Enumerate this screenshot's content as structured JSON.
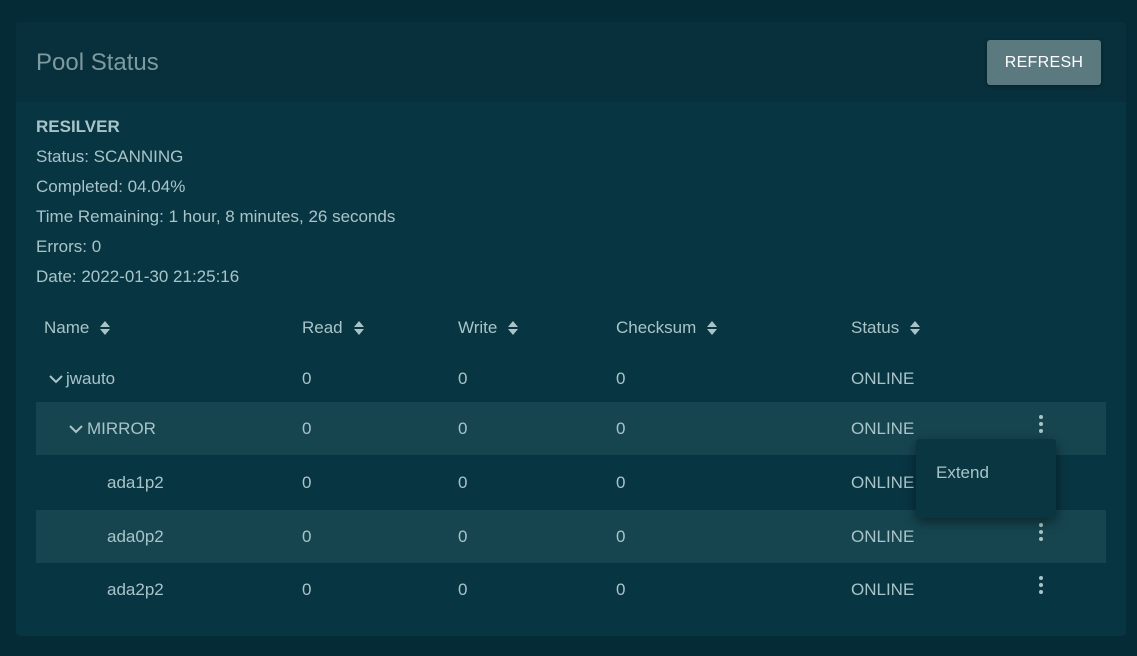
{
  "card": {
    "title": "Pool Status",
    "refresh_label": "REFRESH"
  },
  "resilver": {
    "heading": "RESILVER",
    "status": "Status: SCANNING",
    "completed": "Completed: 04.04%",
    "time_remaining": "Time Remaining: 1 hour, 8 minutes, 26 seconds",
    "errors": "Errors: 0",
    "date": "Date: 2022-01-30 21:25:16"
  },
  "table": {
    "columns": [
      "Name",
      "Read",
      "Write",
      "Checksum",
      "Status"
    ],
    "rows": [
      {
        "name": "jwauto",
        "read": "0",
        "write": "0",
        "checksum": "0",
        "status": "ONLINE"
      },
      {
        "name": "MIRROR",
        "read": "0",
        "write": "0",
        "checksum": "0",
        "status": "ONLINE"
      },
      {
        "name": "ada1p2",
        "read": "0",
        "write": "0",
        "checksum": "0",
        "status": "ONLINE"
      },
      {
        "name": "ada0p2",
        "read": "0",
        "write": "0",
        "checksum": "0",
        "status": "ONLINE"
      },
      {
        "name": "ada2p2",
        "read": "0",
        "write": "0",
        "checksum": "0",
        "status": "ONLINE"
      }
    ]
  },
  "context_menu": {
    "items": [
      {
        "label": "Extend"
      }
    ]
  },
  "icons": {
    "sort": "sort-icon",
    "expand": "chevron-down-icon",
    "actions": "more-vert-icon"
  },
  "colors": {
    "background": "#052b36",
    "card": "#083542",
    "header": "#07303c",
    "row_highlight": "#164550",
    "text": "#a9c4c9",
    "button": "#5a7a80"
  }
}
